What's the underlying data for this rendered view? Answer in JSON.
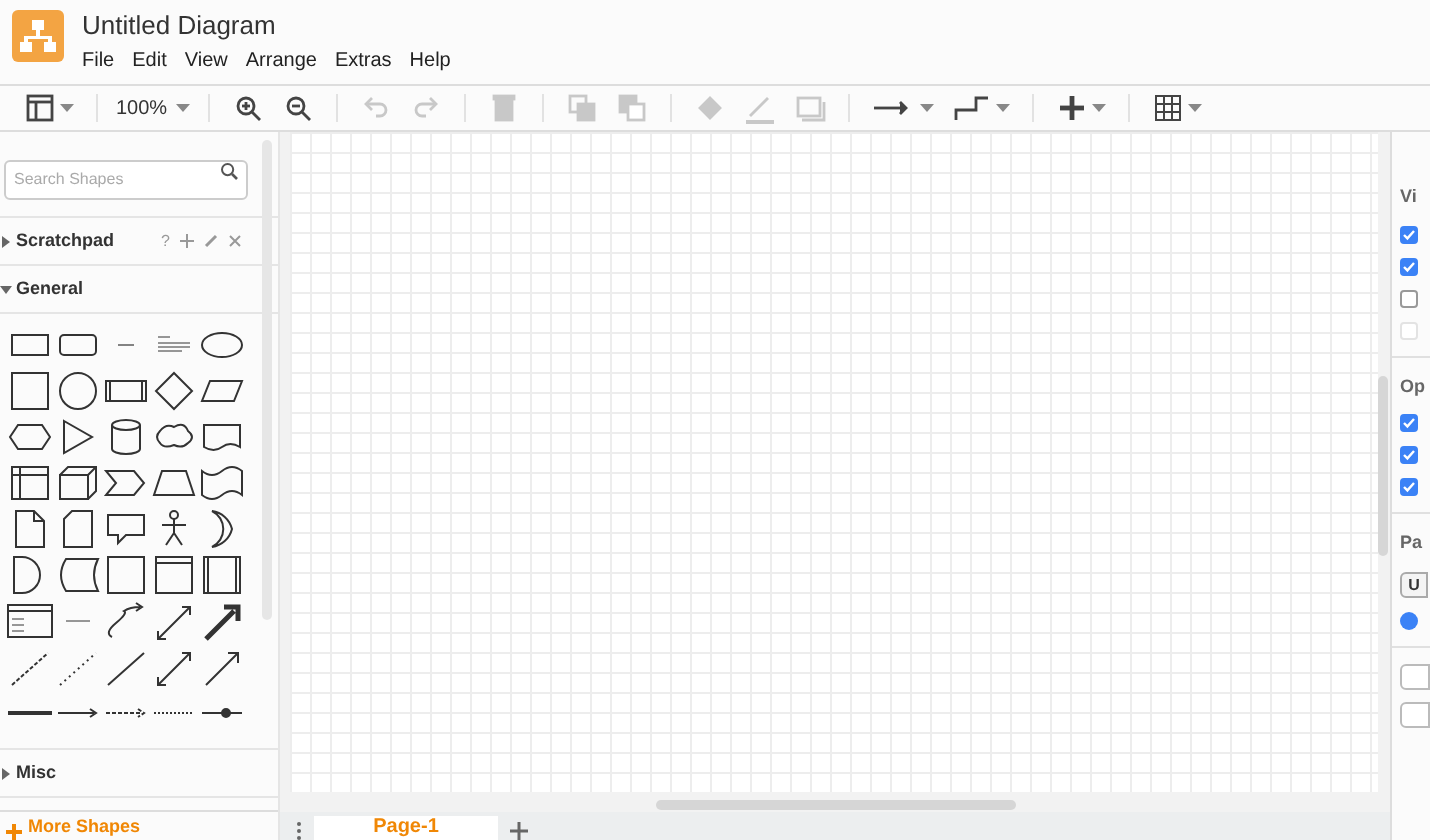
{
  "window": {
    "title": "Untitled Diagram"
  },
  "menu": [
    "File",
    "Edit",
    "View",
    "Arrange",
    "Extras",
    "Help"
  ],
  "toolbar": [
    {
      "kind": "panel",
      "disabled": false
    },
    {
      "kind": "sep"
    },
    {
      "kind": "zoom",
      "label": "100%",
      "disabled": false
    },
    {
      "kind": "sep"
    },
    {
      "kind": "zoomin",
      "disabled": false
    },
    {
      "kind": "zoomout",
      "disabled": false
    },
    {
      "kind": "sep"
    },
    {
      "kind": "undo",
      "disabled": true
    },
    {
      "kind": "redo",
      "disabled": true
    },
    {
      "kind": "sep"
    },
    {
      "kind": "delete",
      "disabled": true
    },
    {
      "kind": "sep"
    },
    {
      "kind": "front",
      "disabled": true
    },
    {
      "kind": "back",
      "disabled": true
    },
    {
      "kind": "sep"
    },
    {
      "kind": "fill",
      "disabled": true
    },
    {
      "kind": "line",
      "disabled": true
    },
    {
      "kind": "shadow",
      "disabled": true
    },
    {
      "kind": "sep"
    },
    {
      "kind": "connection",
      "disabled": false
    },
    {
      "kind": "waypoint",
      "disabled": false
    },
    {
      "kind": "sep"
    },
    {
      "kind": "insert",
      "disabled": false
    },
    {
      "kind": "sep"
    },
    {
      "kind": "table",
      "disabled": false
    }
  ],
  "sidebar": {
    "search": {
      "placeholder": "Search Shapes"
    },
    "sections": [
      {
        "title": "Scratchpad",
        "expanded": false,
        "help": "?"
      },
      {
        "title": "General",
        "expanded": true
      },
      {
        "title": "Misc",
        "expanded": false
      }
    ],
    "more_button": "More Shapes"
  },
  "format_panel": {
    "sections": [
      {
        "title": "Vi",
        "checkboxes": [
          {
            "checked": true,
            "disabled": false
          },
          {
            "checked": true,
            "disabled": false
          },
          {
            "checked": false,
            "disabled": false
          },
          {
            "checked": false,
            "disabled": true
          }
        ]
      },
      {
        "title": "Op",
        "checkboxes": [
          {
            "checked": true,
            "disabled": false
          },
          {
            "checked": true,
            "disabled": false
          },
          {
            "checked": true,
            "disabled": false
          }
        ]
      },
      {
        "title": "Pa",
        "button": "U",
        "radio_selected": true
      }
    ]
  },
  "pages": [
    {
      "label": "Page-1",
      "selected": true
    }
  ]
}
